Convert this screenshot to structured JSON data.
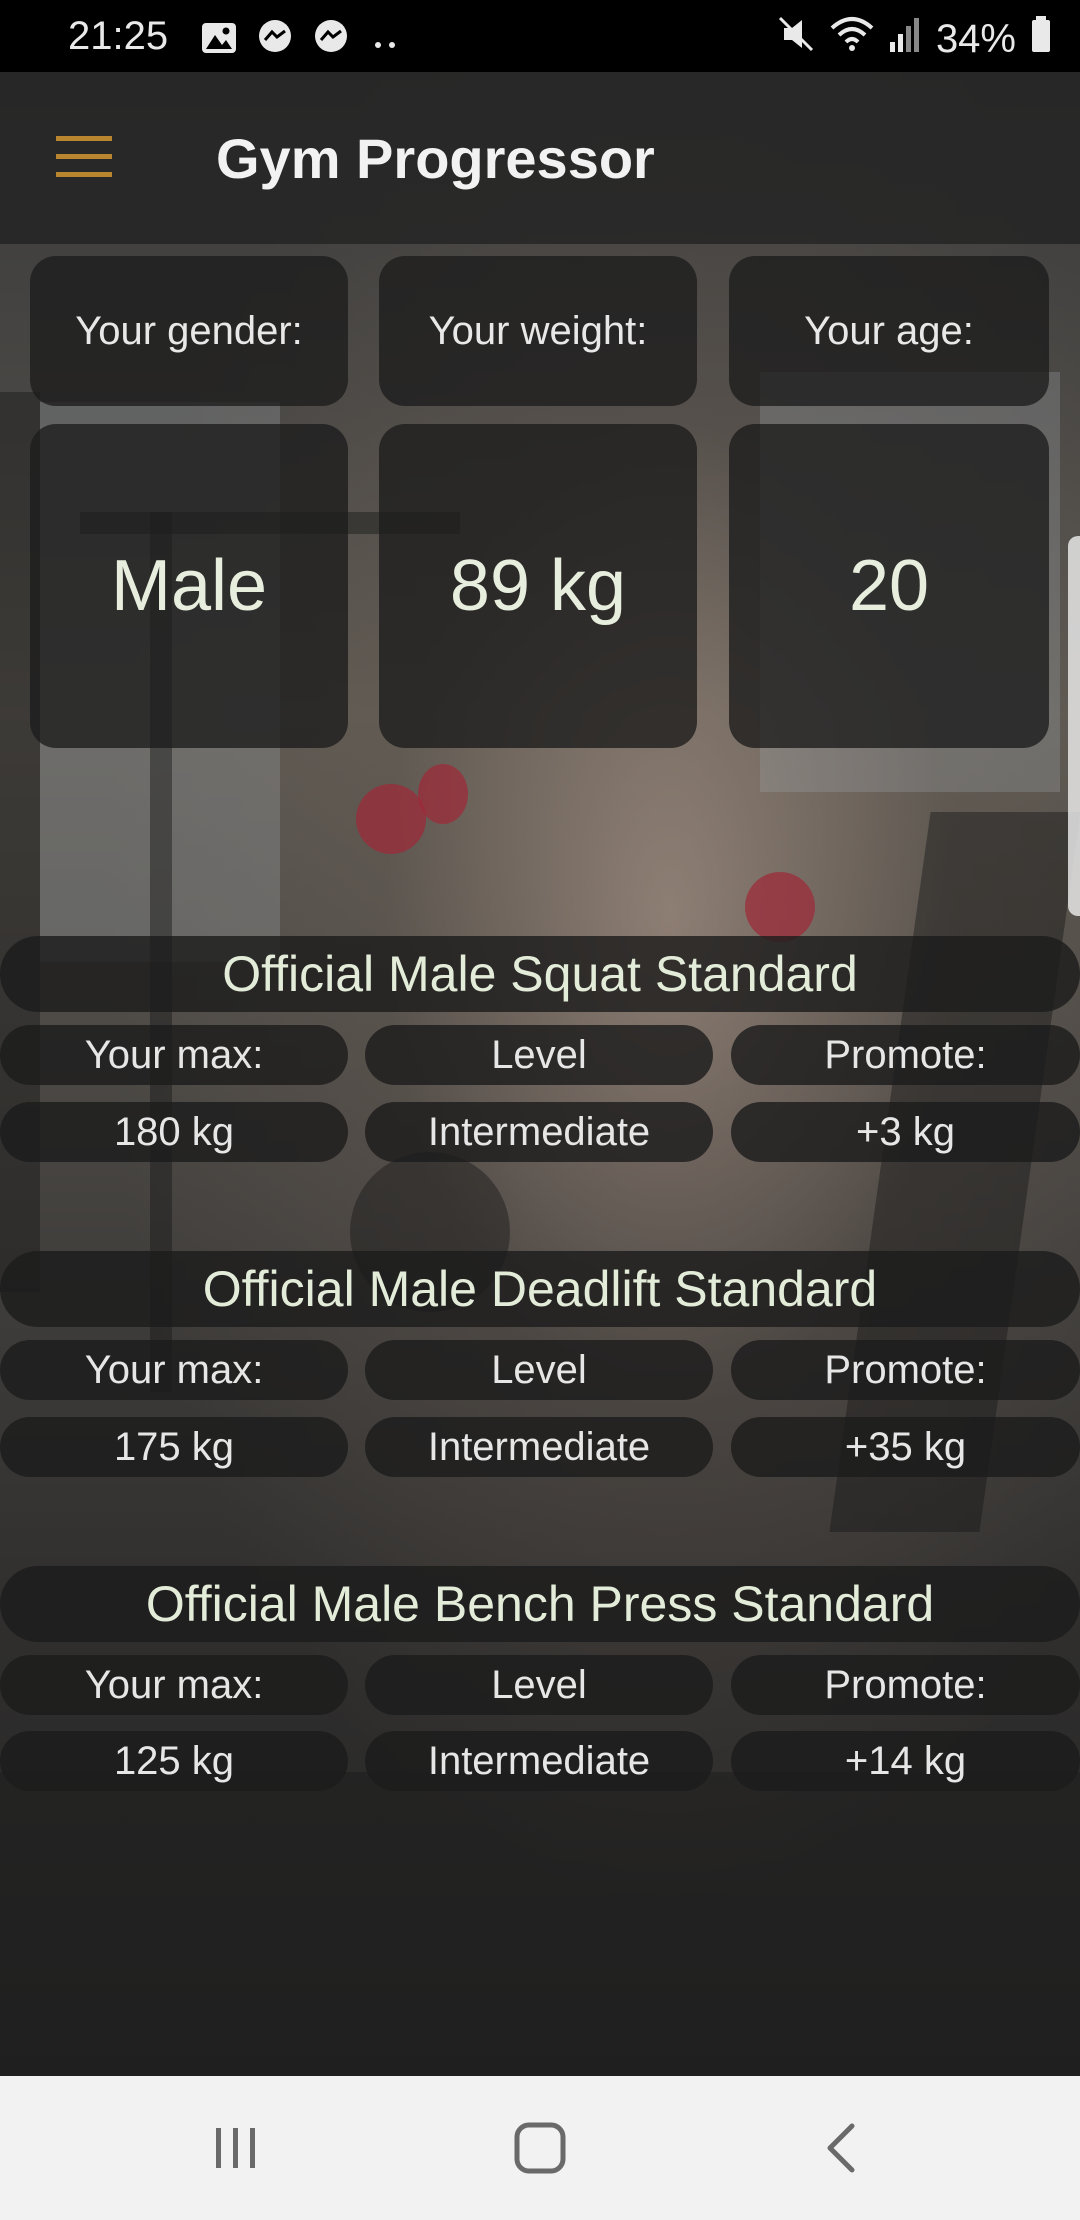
{
  "status_bar": {
    "time": "21:25",
    "battery": "34%",
    "left_icons": [
      "image-icon",
      "messenger-icon",
      "messenger-icon",
      "more-dots-icon"
    ],
    "right_icons": [
      "mute-icon",
      "wifi-icon",
      "signal-icon",
      "battery-icon"
    ]
  },
  "toolbar": {
    "title": "Gym Progressor",
    "menu_icon": "hamburger-menu-icon",
    "accent_color": "#b9862f"
  },
  "profile": {
    "gender_label": "Your gender:",
    "weight_label": "Your weight:",
    "age_label": "Your age:",
    "gender_value": "Male",
    "weight_value": "89 kg",
    "age_value": "20"
  },
  "standards": [
    {
      "title": "Official Male Squat Standard",
      "max_label": "Your max:",
      "level_label": "Level",
      "promote_label": "Promote:",
      "max_value": "180 kg",
      "level_value": "Intermediate",
      "promote_value": "+3 kg"
    },
    {
      "title": "Official Male Deadlift Standard",
      "max_label": "Your max:",
      "level_label": "Level",
      "promote_label": "Promote:",
      "max_value": "175 kg",
      "level_value": "Intermediate",
      "promote_value": "+35 kg"
    },
    {
      "title": "Official Male Bench Press Standard",
      "max_label": "Your max:",
      "level_label": "Level",
      "promote_label": "Promote:",
      "max_value": "125 kg",
      "level_value": "Intermediate",
      "promote_value": "+14 kg"
    }
  ],
  "nav_bar": {
    "icons": [
      "recent-apps-icon",
      "home-icon",
      "back-icon"
    ]
  }
}
